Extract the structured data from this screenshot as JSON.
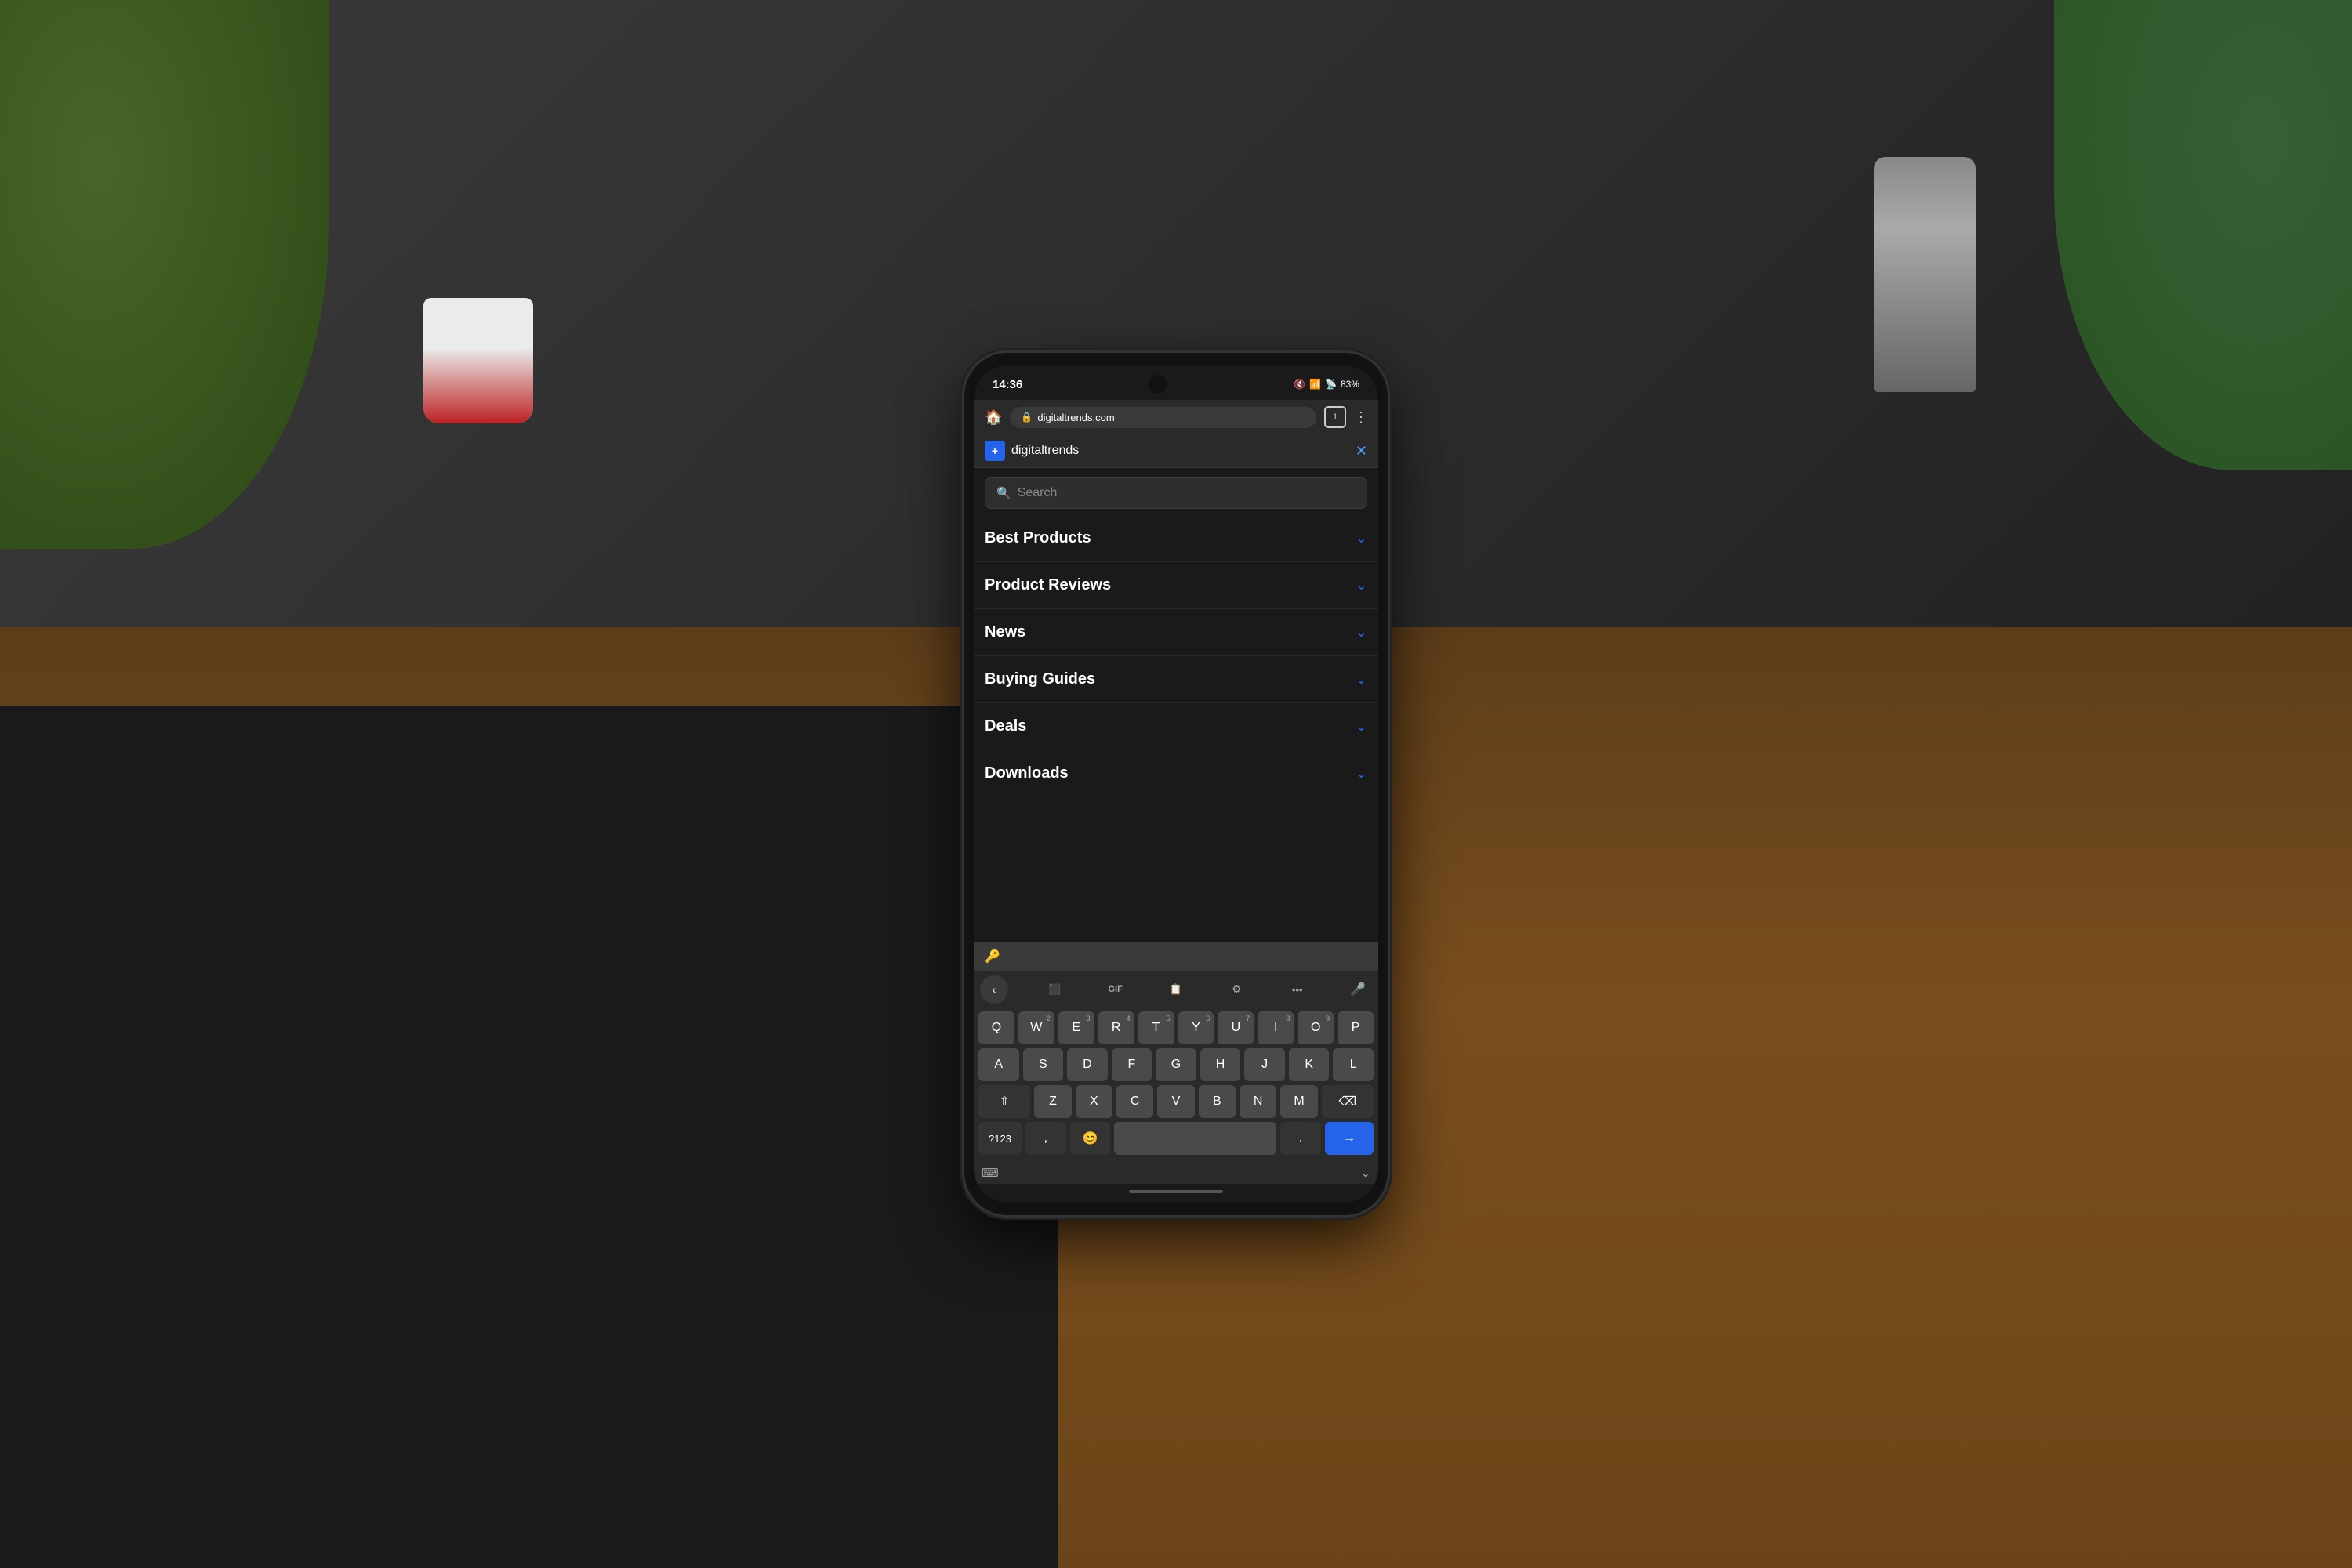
{
  "background": {
    "color": "#2a2a2a"
  },
  "phone": {
    "status_bar": {
      "time": "14:36",
      "battery": "83%",
      "battery_icon": "🔋"
    },
    "browser": {
      "address": "digitaltrends.com",
      "tab_count": "1"
    },
    "menu_bar": {
      "brand_icon": "+",
      "brand_name": "digitaltrends",
      "close_icon": "✕"
    },
    "search": {
      "placeholder": "Search"
    },
    "nav_items": [
      {
        "label": "Best Products",
        "has_chevron": true
      },
      {
        "label": "Product Reviews",
        "has_chevron": true
      },
      {
        "label": "News",
        "has_chevron": true
      },
      {
        "label": "Buying Guides",
        "has_chevron": true
      },
      {
        "label": "Deals",
        "has_chevron": true
      },
      {
        "label": "Downloads",
        "has_chevron": true
      }
    ],
    "keyboard": {
      "row1": [
        "Q",
        "W",
        "E",
        "R",
        "T",
        "Y",
        "U",
        "I",
        "O",
        "P"
      ],
      "row1_nums": [
        "",
        "2",
        "3",
        "4",
        "5",
        "6",
        "7",
        "8",
        "9",
        ""
      ],
      "row2": [
        "A",
        "S",
        "D",
        "F",
        "G",
        "H",
        "J",
        "K",
        "L"
      ],
      "row3": [
        "Z",
        "X",
        "C",
        "V",
        "B",
        "N",
        "M"
      ],
      "special_left": "?123",
      "comma": ",",
      "period": ".",
      "space": "",
      "send_icon": "→",
      "backspace": "⌫",
      "shift": "⇧",
      "emoji": "😊"
    }
  }
}
